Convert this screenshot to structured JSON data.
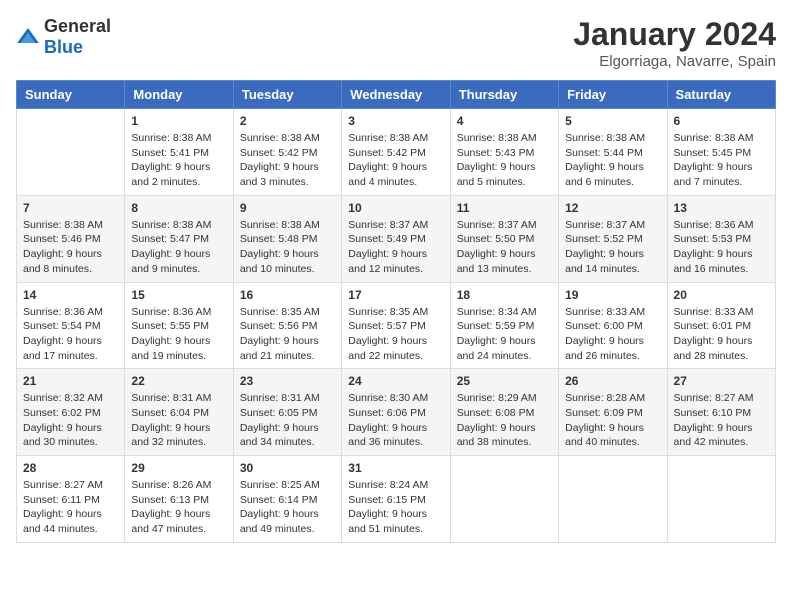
{
  "header": {
    "logo_general": "General",
    "logo_blue": "Blue",
    "month_title": "January 2024",
    "location": "Elgorriaga, Navarre, Spain"
  },
  "days_of_week": [
    "Sunday",
    "Monday",
    "Tuesday",
    "Wednesday",
    "Thursday",
    "Friday",
    "Saturday"
  ],
  "weeks": [
    [
      {
        "day": "",
        "sunrise": "",
        "sunset": "",
        "daylight": ""
      },
      {
        "day": "1",
        "sunrise": "Sunrise: 8:38 AM",
        "sunset": "Sunset: 5:41 PM",
        "daylight": "Daylight: 9 hours and 2 minutes."
      },
      {
        "day": "2",
        "sunrise": "Sunrise: 8:38 AM",
        "sunset": "Sunset: 5:42 PM",
        "daylight": "Daylight: 9 hours and 3 minutes."
      },
      {
        "day": "3",
        "sunrise": "Sunrise: 8:38 AM",
        "sunset": "Sunset: 5:42 PM",
        "daylight": "Daylight: 9 hours and 4 minutes."
      },
      {
        "day": "4",
        "sunrise": "Sunrise: 8:38 AM",
        "sunset": "Sunset: 5:43 PM",
        "daylight": "Daylight: 9 hours and 5 minutes."
      },
      {
        "day": "5",
        "sunrise": "Sunrise: 8:38 AM",
        "sunset": "Sunset: 5:44 PM",
        "daylight": "Daylight: 9 hours and 6 minutes."
      },
      {
        "day": "6",
        "sunrise": "Sunrise: 8:38 AM",
        "sunset": "Sunset: 5:45 PM",
        "daylight": "Daylight: 9 hours and 7 minutes."
      }
    ],
    [
      {
        "day": "7",
        "sunrise": "Sunrise: 8:38 AM",
        "sunset": "Sunset: 5:46 PM",
        "daylight": "Daylight: 9 hours and 8 minutes."
      },
      {
        "day": "8",
        "sunrise": "Sunrise: 8:38 AM",
        "sunset": "Sunset: 5:47 PM",
        "daylight": "Daylight: 9 hours and 9 minutes."
      },
      {
        "day": "9",
        "sunrise": "Sunrise: 8:38 AM",
        "sunset": "Sunset: 5:48 PM",
        "daylight": "Daylight: 9 hours and 10 minutes."
      },
      {
        "day": "10",
        "sunrise": "Sunrise: 8:37 AM",
        "sunset": "Sunset: 5:49 PM",
        "daylight": "Daylight: 9 hours and 12 minutes."
      },
      {
        "day": "11",
        "sunrise": "Sunrise: 8:37 AM",
        "sunset": "Sunset: 5:50 PM",
        "daylight": "Daylight: 9 hours and 13 minutes."
      },
      {
        "day": "12",
        "sunrise": "Sunrise: 8:37 AM",
        "sunset": "Sunset: 5:52 PM",
        "daylight": "Daylight: 9 hours and 14 minutes."
      },
      {
        "day": "13",
        "sunrise": "Sunrise: 8:36 AM",
        "sunset": "Sunset: 5:53 PM",
        "daylight": "Daylight: 9 hours and 16 minutes."
      }
    ],
    [
      {
        "day": "14",
        "sunrise": "Sunrise: 8:36 AM",
        "sunset": "Sunset: 5:54 PM",
        "daylight": "Daylight: 9 hours and 17 minutes."
      },
      {
        "day": "15",
        "sunrise": "Sunrise: 8:36 AM",
        "sunset": "Sunset: 5:55 PM",
        "daylight": "Daylight: 9 hours and 19 minutes."
      },
      {
        "day": "16",
        "sunrise": "Sunrise: 8:35 AM",
        "sunset": "Sunset: 5:56 PM",
        "daylight": "Daylight: 9 hours and 21 minutes."
      },
      {
        "day": "17",
        "sunrise": "Sunrise: 8:35 AM",
        "sunset": "Sunset: 5:57 PM",
        "daylight": "Daylight: 9 hours and 22 minutes."
      },
      {
        "day": "18",
        "sunrise": "Sunrise: 8:34 AM",
        "sunset": "Sunset: 5:59 PM",
        "daylight": "Daylight: 9 hours and 24 minutes."
      },
      {
        "day": "19",
        "sunrise": "Sunrise: 8:33 AM",
        "sunset": "Sunset: 6:00 PM",
        "daylight": "Daylight: 9 hours and 26 minutes."
      },
      {
        "day": "20",
        "sunrise": "Sunrise: 8:33 AM",
        "sunset": "Sunset: 6:01 PM",
        "daylight": "Daylight: 9 hours and 28 minutes."
      }
    ],
    [
      {
        "day": "21",
        "sunrise": "Sunrise: 8:32 AM",
        "sunset": "Sunset: 6:02 PM",
        "daylight": "Daylight: 9 hours and 30 minutes."
      },
      {
        "day": "22",
        "sunrise": "Sunrise: 8:31 AM",
        "sunset": "Sunset: 6:04 PM",
        "daylight": "Daylight: 9 hours and 32 minutes."
      },
      {
        "day": "23",
        "sunrise": "Sunrise: 8:31 AM",
        "sunset": "Sunset: 6:05 PM",
        "daylight": "Daylight: 9 hours and 34 minutes."
      },
      {
        "day": "24",
        "sunrise": "Sunrise: 8:30 AM",
        "sunset": "Sunset: 6:06 PM",
        "daylight": "Daylight: 9 hours and 36 minutes."
      },
      {
        "day": "25",
        "sunrise": "Sunrise: 8:29 AM",
        "sunset": "Sunset: 6:08 PM",
        "daylight": "Daylight: 9 hours and 38 minutes."
      },
      {
        "day": "26",
        "sunrise": "Sunrise: 8:28 AM",
        "sunset": "Sunset: 6:09 PM",
        "daylight": "Daylight: 9 hours and 40 minutes."
      },
      {
        "day": "27",
        "sunrise": "Sunrise: 8:27 AM",
        "sunset": "Sunset: 6:10 PM",
        "daylight": "Daylight: 9 hours and 42 minutes."
      }
    ],
    [
      {
        "day": "28",
        "sunrise": "Sunrise: 8:27 AM",
        "sunset": "Sunset: 6:11 PM",
        "daylight": "Daylight: 9 hours and 44 minutes."
      },
      {
        "day": "29",
        "sunrise": "Sunrise: 8:26 AM",
        "sunset": "Sunset: 6:13 PM",
        "daylight": "Daylight: 9 hours and 47 minutes."
      },
      {
        "day": "30",
        "sunrise": "Sunrise: 8:25 AM",
        "sunset": "Sunset: 6:14 PM",
        "daylight": "Daylight: 9 hours and 49 minutes."
      },
      {
        "day": "31",
        "sunrise": "Sunrise: 8:24 AM",
        "sunset": "Sunset: 6:15 PM",
        "daylight": "Daylight: 9 hours and 51 minutes."
      },
      {
        "day": "",
        "sunrise": "",
        "sunset": "",
        "daylight": ""
      },
      {
        "day": "",
        "sunrise": "",
        "sunset": "",
        "daylight": ""
      },
      {
        "day": "",
        "sunrise": "",
        "sunset": "",
        "daylight": ""
      }
    ]
  ]
}
